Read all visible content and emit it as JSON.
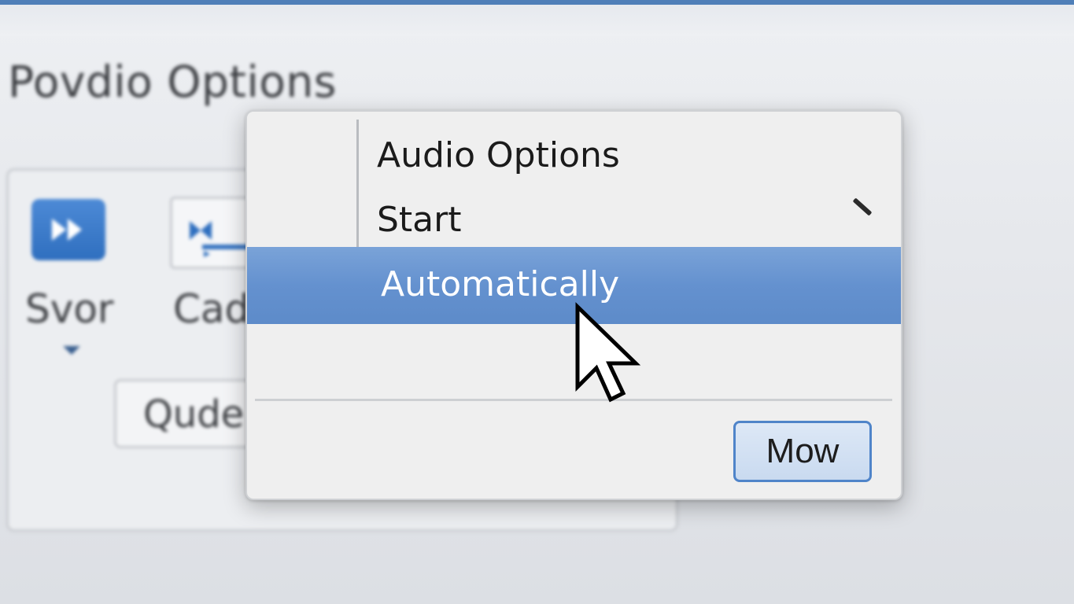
{
  "background": {
    "window_title": "Povdio Options",
    "tools": [
      {
        "label": "Svor",
        "icon": "fast-forward-icon"
      },
      {
        "label": "Cad",
        "icon": "media-icon"
      }
    ],
    "button_label": "Qude"
  },
  "dropdown": {
    "heading": "Audio Options",
    "items": [
      {
        "label": "Start"
      },
      {
        "label": "Automatically",
        "selected": true
      }
    ],
    "confirm_button": "Mow"
  },
  "colors": {
    "accent": "#6491cf",
    "top_bar": "#4f7fb8",
    "button_border": "#4f84c9"
  }
}
